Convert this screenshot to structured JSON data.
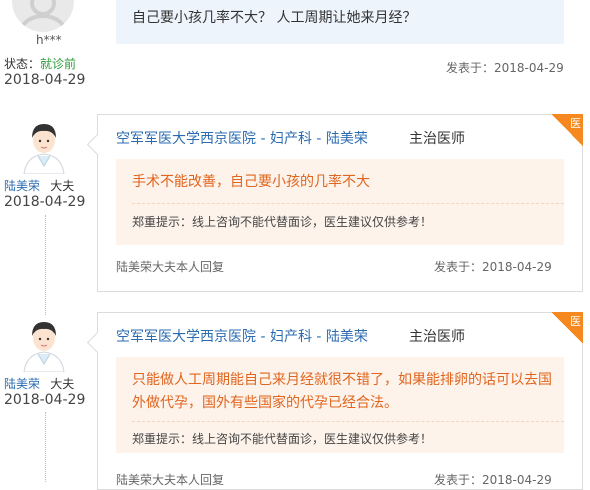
{
  "patient": {
    "name": "h***",
    "status_label": "状态：",
    "status_value": "就诊前",
    "date": "2018-04-29",
    "question": "自己要小孩几率不大？ 人工周期让她来月经？",
    "sent_label": "发表于：",
    "sent_date": "2018-04-29"
  },
  "replies": [
    {
      "doctor_name": "陆美荣",
      "doctor_title": "大夫",
      "date": "2018-04-29",
      "hospital_line": "空军军医大学西京医院 - 妇产科 - 陆美荣",
      "position": "主治医师",
      "badge": "医",
      "answer_line1": "手术不能改善，自己要小孩的几率不大",
      "answer_line2": "",
      "notice": "郑重提示：线上咨询不能代替面诊，医生建议仅供参考！",
      "reply_note": "陆美荣大夫本人回复",
      "sent_label": "发表于：",
      "sent_date": "2018-04-29"
    },
    {
      "doctor_name": "陆美荣",
      "doctor_title": "大夫",
      "date": "2018-04-29",
      "hospital_line": "空军军医大学西京医院 - 妇产科 - 陆美荣",
      "position": "主治医师",
      "badge": "医",
      "answer_line1": "只能做人工周期能自己来月经就很不错了，如果能排卵的话可以去国",
      "answer_line2": "外做代孕，国外有些国家的代孕已经合法。",
      "notice": "郑重提示：线上咨询不能代替面诊，医生建议仅供参考！",
      "reply_note": "陆美荣大夫本人回复",
      "sent_label": "发表于：",
      "sent_date": "2018-04-29"
    }
  ]
}
